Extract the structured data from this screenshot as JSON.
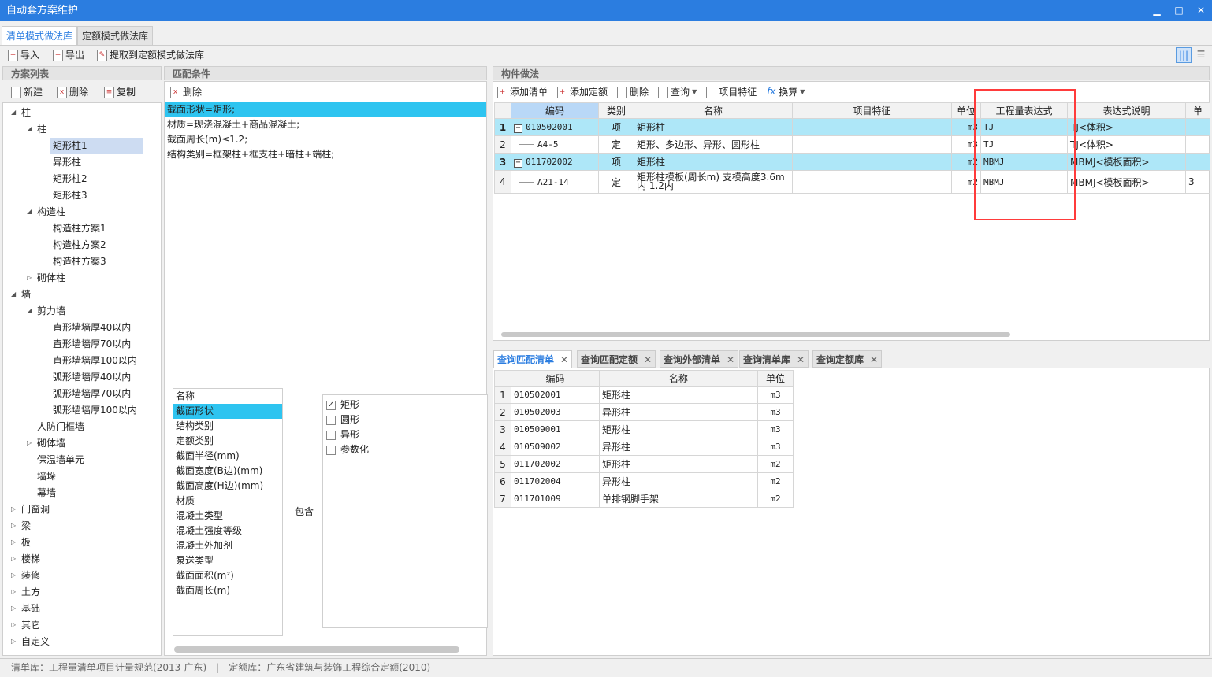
{
  "window": {
    "title": "自动套方案维护",
    "controls": [
      "▁",
      "□",
      "✕"
    ]
  },
  "main_tabs": [
    {
      "label": "清单模式做法库",
      "active": true
    },
    {
      "label": "定额模式做法库",
      "active": false
    }
  ],
  "toolbar": {
    "import": "导入",
    "export": "导出",
    "extract": "提取到定额模式做法库"
  },
  "scheme_panel": {
    "title": "方案列表",
    "new": "新建",
    "delete": "删除",
    "copy": "复制",
    "tree": [
      {
        "label": "柱",
        "level": 0,
        "state": "expanded"
      },
      {
        "label": "柱",
        "level": 1,
        "state": "expanded"
      },
      {
        "label": "矩形柱1",
        "level": 2,
        "selected": true
      },
      {
        "label": "异形柱",
        "level": 2
      },
      {
        "label": "矩形柱2",
        "level": 2
      },
      {
        "label": "矩形柱3",
        "level": 2
      },
      {
        "label": "构造柱",
        "level": 1,
        "state": "expanded"
      },
      {
        "label": "构造柱方案1",
        "level": 2
      },
      {
        "label": "构造柱方案2",
        "level": 2
      },
      {
        "label": "构造柱方案3",
        "level": 2
      },
      {
        "label": "砌体柱",
        "level": 1,
        "state": "collapsed"
      },
      {
        "label": "墙",
        "level": 0,
        "state": "expanded"
      },
      {
        "label": "剪力墙",
        "level": 1,
        "state": "expanded"
      },
      {
        "label": "直形墙墙厚40以内",
        "level": 2
      },
      {
        "label": "直形墙墙厚70以内",
        "level": 2
      },
      {
        "label": "直形墙墙厚100以内",
        "level": 2
      },
      {
        "label": "弧形墙墙厚40以内",
        "level": 2
      },
      {
        "label": "弧形墙墙厚70以内",
        "level": 2
      },
      {
        "label": "弧形墙墙厚100以内",
        "level": 2
      },
      {
        "label": "人防门框墙",
        "level": 1
      },
      {
        "label": "砌体墙",
        "level": 1,
        "state": "collapsed"
      },
      {
        "label": "保温墙单元",
        "level": 1
      },
      {
        "label": "墙垛",
        "level": 1
      },
      {
        "label": "幕墙",
        "level": 1
      },
      {
        "label": "门窗洞",
        "level": 0,
        "state": "collapsed"
      },
      {
        "label": "梁",
        "level": 0,
        "state": "collapsed"
      },
      {
        "label": "板",
        "level": 0,
        "state": "collapsed"
      },
      {
        "label": "楼梯",
        "level": 0,
        "state": "collapsed"
      },
      {
        "label": "装修",
        "level": 0,
        "state": "collapsed"
      },
      {
        "label": "土方",
        "level": 0,
        "state": "collapsed"
      },
      {
        "label": "基础",
        "level": 0,
        "state": "collapsed"
      },
      {
        "label": "其它",
        "level": 0,
        "state": "collapsed"
      },
      {
        "label": "自定义",
        "level": 0,
        "state": "collapsed"
      }
    ]
  },
  "match_panel": {
    "title": "匹配条件",
    "delete": "删除",
    "conditions": [
      "截面形状=矩形;",
      "材质=现浇混凝土+商品混凝土;",
      "截面周长(m)≤1.2;",
      "结构类别=框架柱+框支柱+暗柱+端柱;"
    ],
    "attributes": [
      "名称",
      "截面形状",
      "结构类别",
      "定额类别",
      "截面半径(mm)",
      "截面宽度(B边)(mm)",
      "截面高度(H边)(mm)",
      "材质",
      "混凝土类型",
      "混凝土强度等级",
      "混凝土外加剂",
      "泵送类型",
      "截面面积(m²)",
      "截面周长(m)"
    ],
    "selected_attribute": "截面形状",
    "operator": "包含",
    "values": [
      {
        "label": "矩形",
        "checked": true
      },
      {
        "label": "圆形",
        "checked": false
      },
      {
        "label": "异形",
        "checked": false
      },
      {
        "label": "参数化",
        "checked": false
      }
    ]
  },
  "method_panel": {
    "title": "构件做法",
    "toolbar": [
      "添加清单",
      "添加定额",
      "删除",
      "查询",
      "项目特征",
      "换算"
    ],
    "columns": [
      "编码",
      "类别",
      "名称",
      "项目特征",
      "单位",
      "工程量表达式",
      "表达式说明",
      "单"
    ],
    "rows": [
      {
        "n": "1",
        "code": "010502001",
        "type": "项",
        "name": "矩形柱",
        "feature": "",
        "unit": "m3",
        "expr": "TJ",
        "desc": "TJ<体积>",
        "extra": "",
        "item": true
      },
      {
        "n": "2",
        "code": "A4-5",
        "type": "定",
        "name": "矩形、多边形、异形、圆形柱",
        "feature": "",
        "unit": "m3",
        "expr": "TJ",
        "desc": "TJ<体积>",
        "extra": ""
      },
      {
        "n": "3",
        "code": "011702002",
        "type": "项",
        "name": "矩形柱",
        "feature": "",
        "unit": "m2",
        "expr": "MBMJ",
        "desc": "MBMJ<模板面积>",
        "extra": "",
        "item": true
      },
      {
        "n": "4",
        "code": "A21-14",
        "type": "定",
        "name": "矩形柱模板(周长m) 支模高度3.6m内 1.2内",
        "feature": "",
        "unit": "m2",
        "expr": "MBMJ",
        "desc": "MBMJ<模板面积>",
        "extra": "3"
      }
    ],
    "highlight_color": "#ff3b3b"
  },
  "query_panel": {
    "tabs": [
      "查询匹配清单",
      "查询匹配定额",
      "查询外部清单",
      "查询清单库",
      "查询定额库"
    ],
    "columns": [
      "编码",
      "名称",
      "单位"
    ],
    "rows": [
      [
        "1",
        "010502001",
        "矩形柱",
        "m3"
      ],
      [
        "2",
        "010502003",
        "异形柱",
        "m3"
      ],
      [
        "3",
        "010509001",
        "矩形柱",
        "m3"
      ],
      [
        "4",
        "010509002",
        "异形柱",
        "m3"
      ],
      [
        "5",
        "011702002",
        "矩形柱",
        "m2"
      ],
      [
        "6",
        "011702004",
        "异形柱",
        "m2"
      ],
      [
        "7",
        "011701009",
        "单排钢脚手架",
        "m2"
      ]
    ]
  },
  "status": {
    "list_lib": "清单库：工程量清单项目计量规范(2013-广东)",
    "quota_lib": "定额库：广东省建筑与装饰工程综合定额(2010)"
  }
}
